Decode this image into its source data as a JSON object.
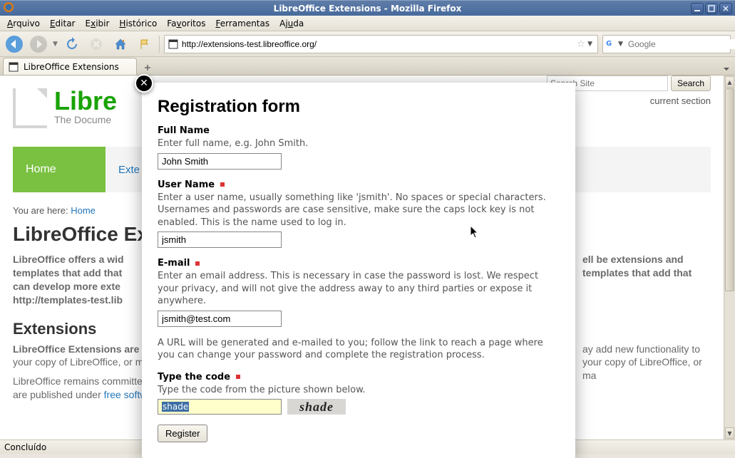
{
  "window": {
    "title": "LibreOffice Extensions - Mozilla Firefox"
  },
  "menu": {
    "arquivo": "Arquivo",
    "editar": "Editar",
    "exibir": "Exibir",
    "historico": "Histórico",
    "favoritos": "Favoritos",
    "ferramentas": "Ferramentas",
    "ajuda": "Ajuda"
  },
  "url": "http://extensions-test.libreoffice.org/",
  "search_placeholder": "Google",
  "tab": {
    "title": "LibreOffice Extensions"
  },
  "site": {
    "search_placeholder": "Search Site",
    "search_button": "Search",
    "section_hint": "current section",
    "logo_name": "Libre",
    "logo_tag": "The Docume",
    "nav": {
      "home": "Home",
      "ext": "Exte"
    },
    "crumb_prefix": "You are here:",
    "crumb_home": "Home",
    "h1": "LibreOffice Exte",
    "p1_a": "LibreOffice offers a wid",
    "p1_b": "ell be extensions and templates that add that",
    "p1_c": "people, maybe you, can develop more exte",
    "p1_d": "lates go to http://templates-test.lib",
    "h2": "Extensions",
    "p2_a": "LibreOffice Extensions are t",
    "p2_b": "ay add new functionality to your copy of LibreOffice, or ma",
    "p3_a": "LibreOffice remains committed",
    "p3_b": "e of extensions and templates are published under ",
    "p3_link": "free software licenses",
    "p3_c": "."
  },
  "modal": {
    "title": "Registration form",
    "full_name_label": "Full Name",
    "full_name_help": "Enter full name, e.g. John Smith.",
    "full_name_value": "John Smith",
    "user_name_label": "User Name",
    "user_name_help": "Enter a user name, usually something like 'jsmith'. No spaces or special characters. Usernames and passwords are case sensitive, make sure the caps lock key is not enabled. This is the name used to log in.",
    "user_name_value": "jsmith",
    "email_label": "E-mail",
    "email_help": "Enter an email address. This is necessary in case the password is lost. We respect your privacy, and will not give the address away to any third parties or expose it anywhere.",
    "email_value": "jsmith@test.com",
    "email_note": "A URL will be generated and e-mailed to you; follow the link to reach a page where you can change your password and complete the registration process.",
    "code_label": "Type the code",
    "code_help": "Type the code from the picture shown below.",
    "code_value": "shade",
    "captcha_image_text": "shade",
    "register": "Register"
  },
  "status": "Concluído"
}
